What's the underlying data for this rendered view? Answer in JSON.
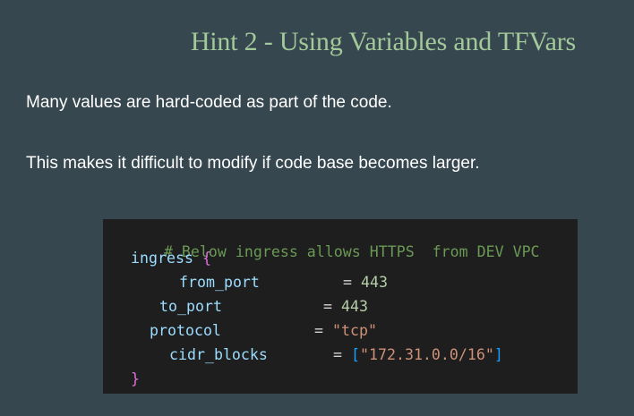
{
  "slide": {
    "title": "Hint 2 - Using Variables and TFVars",
    "paragraphs": [
      "Many values are hard-coded as part of the code.",
      "This makes it difficult to modify if code base becomes larger."
    ]
  },
  "code": {
    "comment": "# Below ingress allows HTTPS  from DEV VPC",
    "block_name": "ingress",
    "open_brace": "{",
    "close_brace": "}",
    "equals": "=",
    "from_port": {
      "key": "from_port",
      "value": "443"
    },
    "to_port": {
      "key": "to_port",
      "value": "443"
    },
    "protocol": {
      "key": "protocol",
      "value": "\"tcp\""
    },
    "cidr_blocks": {
      "key": "cidr_blocks",
      "open_bracket": "[",
      "value": "\"172.31.0.0/16\"",
      "close_bracket": "]"
    }
  },
  "colors": {
    "background": "#36474f",
    "title": "#a3c99a",
    "text": "#ffffff",
    "code_background": "#1e1e1e"
  }
}
